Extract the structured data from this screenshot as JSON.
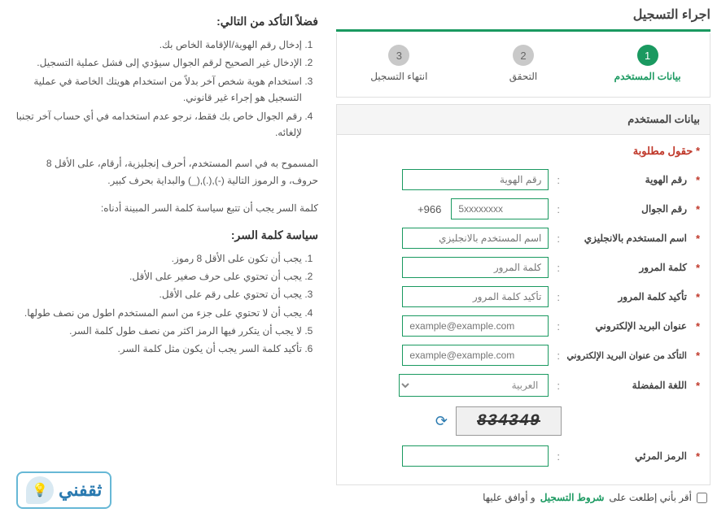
{
  "header": {
    "title": "اجراء التسجيل"
  },
  "steps": [
    {
      "num": "1",
      "label": "بيانات المستخدم",
      "active": true
    },
    {
      "num": "2",
      "label": "التحقق",
      "active": false
    },
    {
      "num": "3",
      "label": "انتهاء التسجيل",
      "active": false
    }
  ],
  "panel": {
    "title": "بيانات المستخدم",
    "required_hint": "حقول مطلوبة",
    "fields": {
      "id": {
        "label": "رقم الهوية",
        "placeholder": "رقم الهوية"
      },
      "mobile": {
        "label": "رقم الجوال",
        "placeholder": "5xxxxxxxx",
        "code": "+966"
      },
      "username": {
        "label": "اسم المستخدم بالانجليزي",
        "placeholder": "اسم المستخدم بالانجليزي"
      },
      "password": {
        "label": "كلمة المرور",
        "placeholder": "كلمة المرور"
      },
      "password_confirm": {
        "label": "تأكيد كلمة المرور",
        "placeholder": "تأكيد كلمة المرور"
      },
      "email": {
        "label": "عنوان البريد الإلكتروني",
        "placeholder": "example@example.com"
      },
      "email_confirm": {
        "label": "التأكد من عنوان البريد الإلكتروني",
        "placeholder": "example@example.com"
      },
      "lang": {
        "label": "اللغة المفضلة",
        "selected": "العربية"
      },
      "captcha": {
        "label": "الرمز المرئي",
        "value": "834349"
      }
    }
  },
  "agree": {
    "prefix": "أقر بأني إطلعت على",
    "link": "شروط التسجيل",
    "suffix": "و أوافق عليها"
  },
  "instructions": {
    "h1": "فضلاً التأكد من التالي:",
    "list1": [
      "إدخال رقم الهوية/الإقامة الخاص بك.",
      "الإدخال غير الصحيح لرقم الجوال سيؤدي إلى فشل عملية التسجيل.",
      "استخدام هوية شخص آخر بدلاً من استخدام هويتك الخاصة في عملية التسجيل هو إجراء غير قانوني.",
      "رقم الجوال خاص بك فقط، نرجو عدم استخدامه في أي حساب آخر تجنبا لإلغائه."
    ],
    "p1": "المسموح به في اسم المستخدم، أحرف إنجليزية، أرقام، على الأقل 8 حروف، و الرموز التالية (-),(.),(_) والبداية بحرف كبير.",
    "p2": "كلمة السر يجب أن تتبع سياسة كلمة السر المبينة أدناه:",
    "h2": "سياسة كلمة السر:",
    "list2": [
      "يجب أن تكون على الأقل 8 رموز.",
      "يجب أن تحتوي على حرف صغير على الأقل.",
      "يجب أن تحتوي على رقم على الأقل.",
      "يجب أن لا تحتوي على جزء من اسم المستخدم اطول من نصف طولها.",
      "لا يجب أن يتكرر فيها الرمز اكثر من نصف طول كلمة السر.",
      "تأكيد كلمة السر يجب أن يكون مثل كلمة السر."
    ]
  },
  "logo": {
    "text": "ثقفني"
  }
}
